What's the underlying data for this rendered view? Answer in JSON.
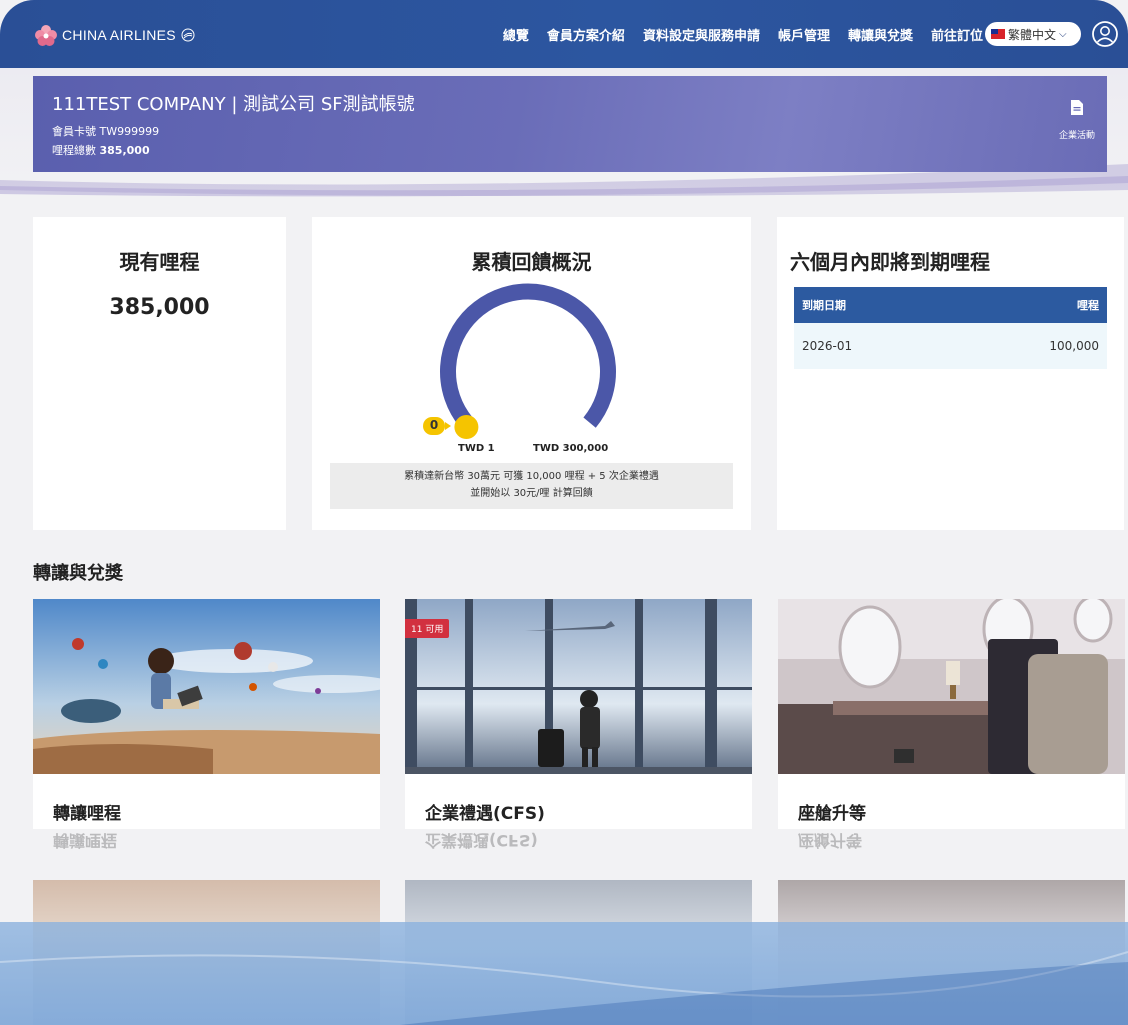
{
  "header": {
    "logo_text": "CHINA AIRLINES",
    "nav": [
      "總覽",
      "會員方案介紹",
      "資料設定與服務申請",
      "帳戶管理",
      "轉讓與兌獎",
      "前往訂位"
    ],
    "language": "繁體中文"
  },
  "account": {
    "company": "111TEST COMPANY | 測試公司 SF測試帳號",
    "card_label": "會員卡號",
    "card_no": "TW999999",
    "miles_label": "哩程總數",
    "miles_total": "385,000",
    "corporate_activity": "企業活動"
  },
  "current_miles": {
    "title": "現有哩程",
    "value": "385,000"
  },
  "rebate": {
    "title": "累積回饋概況",
    "marker_value": "0",
    "progress": 0,
    "start_label": "TWD 1",
    "end_label": "TWD 300,000",
    "note_line1": "累積達新台幣 30萬元 可獲 10,000 哩程 + 5 次企業禮遇",
    "note_line2": "並開始以 30元/哩 計算回饋"
  },
  "expiring": {
    "title": "六個月內即將到期哩程",
    "col_date": "到期日期",
    "col_miles": "哩程",
    "rows": [
      {
        "date": "2026-01",
        "miles": "100,000"
      }
    ]
  },
  "transfer": {
    "section_title": "轉讓與兌獎",
    "tiles": [
      {
        "label": "轉讓哩程"
      },
      {
        "label": "企業禮遇(CFS)",
        "badge": "11 可用"
      },
      {
        "label": "座艙升等"
      }
    ]
  },
  "colors": {
    "nav_bg": "#2b52a0",
    "banner": "#6468b4",
    "gauge": "#4b57a8",
    "badge": "#d2303f",
    "marker": "#f5c400"
  }
}
